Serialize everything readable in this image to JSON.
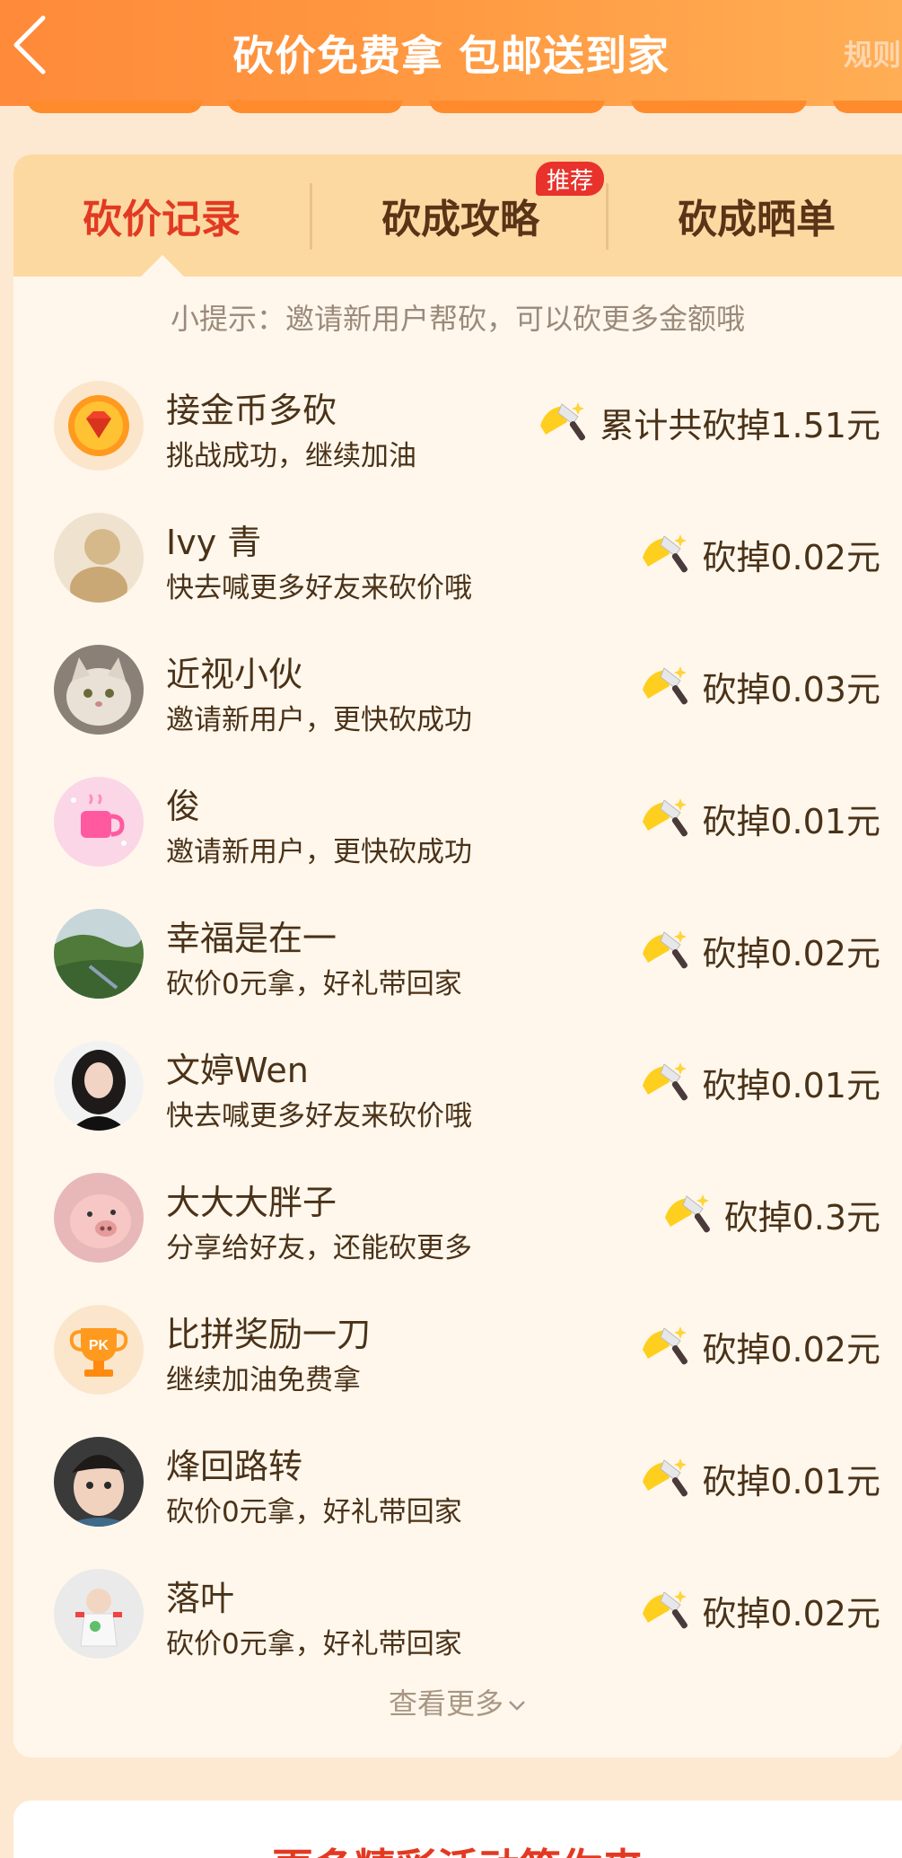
{
  "header": {
    "title": "砍价免费拿 包邮送到家",
    "rules": "规则"
  },
  "tabs": [
    {
      "label": "砍价记录",
      "active": true
    },
    {
      "label": "砍成攻略",
      "badge": "推荐"
    },
    {
      "label": "砍成晒单"
    }
  ],
  "hint": "小提示：邀请新用户帮砍，可以砍更多金额哦",
  "records": [
    {
      "name": "接金币多砍",
      "sub": "挑战成功，继续加油",
      "amount": "累计共砍掉1.51元",
      "avatar": "gem-coin-icon"
    },
    {
      "name": "Ivy 青",
      "sub": "快去喊更多好友来砍价哦",
      "amount": "砍掉0.02元",
      "avatar": "user-photo"
    },
    {
      "name": "近视小伙",
      "sub": "邀请新用户，更快砍成功",
      "amount": "砍掉0.03元",
      "avatar": "cat-photo"
    },
    {
      "name": "俊",
      "sub": "邀请新用户，更快砍成功",
      "amount": "砍掉0.01元",
      "avatar": "mug-icon"
    },
    {
      "name": "幸福是在一",
      "sub": "砍价0元拿，好礼带回家",
      "amount": "砍掉0.02元",
      "avatar": "landscape-photo"
    },
    {
      "name": "文婷Wen",
      "sub": "快去喊更多好友来砍价哦",
      "amount": "砍掉0.01元",
      "avatar": "portrait-photo"
    },
    {
      "name": "大大大胖子",
      "sub": "分享给好友，还能砍更多",
      "amount": "砍掉0.3元",
      "avatar": "pig-photo"
    },
    {
      "name": "比拼奖励一刀",
      "sub": "继续加油免费拿",
      "amount": "砍掉0.02元",
      "avatar": "pk-trophy-icon"
    },
    {
      "name": "烽回路转",
      "sub": "砍价0元拿，好礼带回家",
      "amount": "砍掉0.01元",
      "avatar": "child-photo"
    },
    {
      "name": "落叶",
      "sub": "砍价0元拿，好礼带回家",
      "amount": "砍掉0.02元",
      "avatar": "toddler-photo"
    }
  ],
  "see_more": "查看更多",
  "bottom_title": "更多精彩活动等你来",
  "colors": {
    "accent": "#e23a22",
    "header": "#ff9840",
    "card": "#fff7ec",
    "tabs_bg": "#fdd9a2"
  }
}
